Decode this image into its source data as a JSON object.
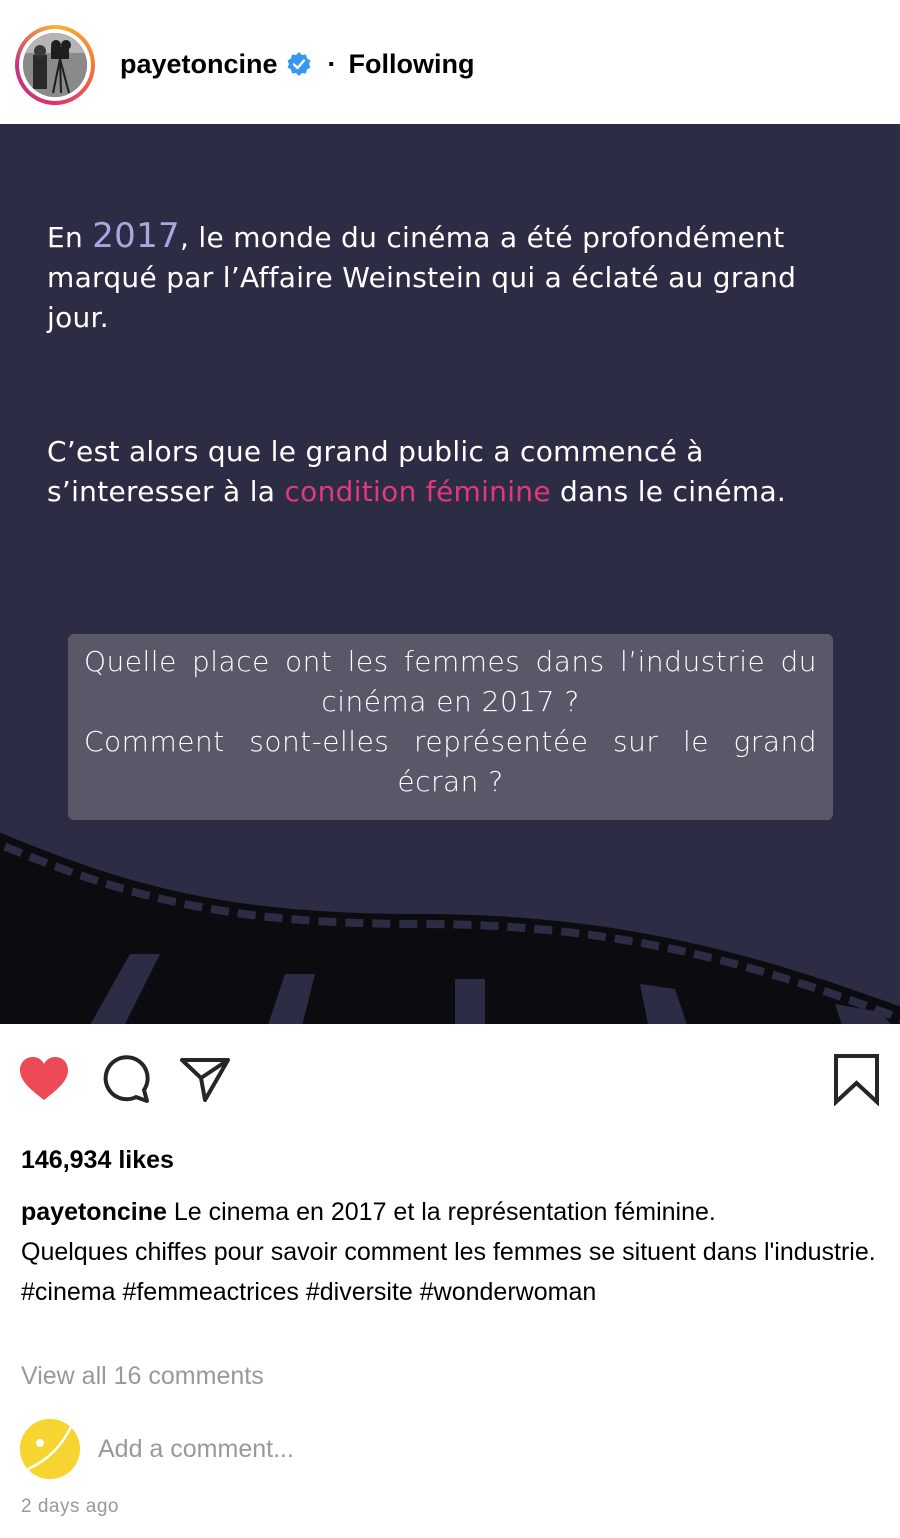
{
  "header": {
    "username": "payetoncine",
    "verified_icon": "verified-badge-icon",
    "separator": "·",
    "follow_status": "Following"
  },
  "post_image": {
    "para1": {
      "lead": "En ",
      "year": "2017",
      "rest": ", le monde du cinéma a été profondément marqué par l’Affaire Weinstein qui a éclaté au grand jour."
    },
    "para2": {
      "lead": "C’est alors que le grand public a commencé à s’interesser à la ",
      "highlight": "condition féminine",
      "rest": " dans le cinéma."
    },
    "question": {
      "line1": "Quelle place ont les femmes dans l’industrie du cinéma en 2017 ?",
      "line2": "Comment sont-elles représentée sur le grand écran ?"
    },
    "colors": {
      "background": "#2c2d44",
      "year": "#a7a8e0",
      "highlight": "#e0397a",
      "box": "#585869"
    }
  },
  "actions": {
    "like_icon": "heart-filled-icon",
    "comment_icon": "comment-icon",
    "share_icon": "paper-plane-icon",
    "save_icon": "bookmark-icon",
    "like_color": "#ed4956"
  },
  "likes": "146,934 likes",
  "caption": {
    "username": "payetoncine",
    "text_line1": " Le cinema en 2017 et la représentation féminine.",
    "text_line2": "Quelques chiffes pour savoir comment les femmes se situent dans l'industrie.",
    "hashtags": "#cinema #femmeactrices #diversite #wonderwoman"
  },
  "view_comments": "View all 16 comments",
  "add_comment": {
    "placeholder": "Add a comment..."
  },
  "timestamp": "2 days ago"
}
